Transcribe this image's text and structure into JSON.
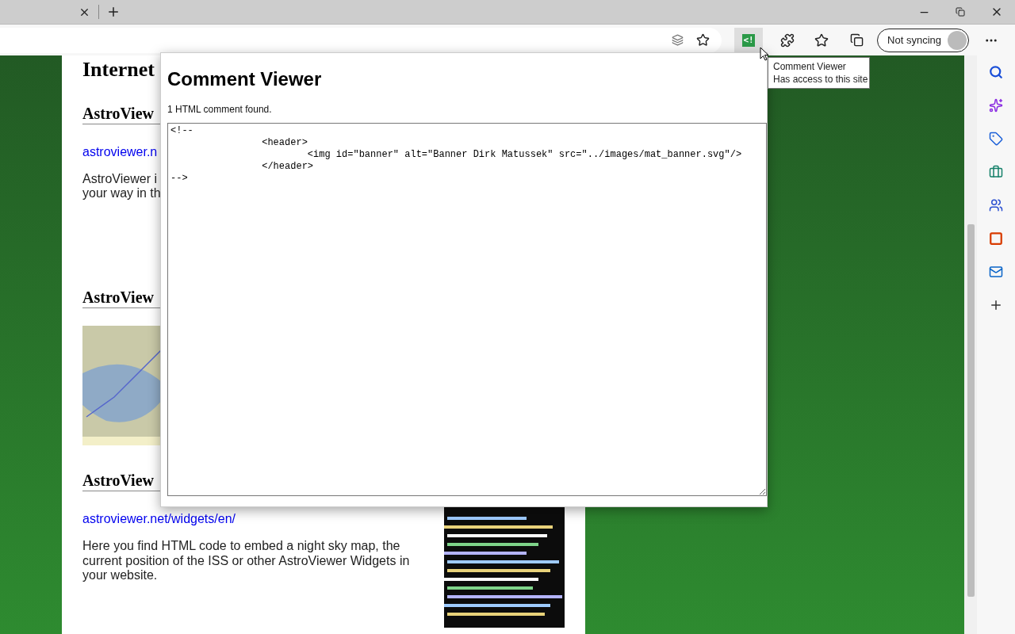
{
  "toolbar": {
    "extension_badge": "<!",
    "sync_button": "Not syncing"
  },
  "tooltip": {
    "title": "Comment Viewer",
    "subtitle": "Has access to this site"
  },
  "popup": {
    "title": "Comment Viewer",
    "count": "1 HTML comment found.",
    "code": "<!--\n\t\t<header>\n\t\t\t<img id=\"banner\" alt=\"Banner Dirk Matussek\" src=\"../images/mat_banner.svg\"/>\n\t\t</header>\n-->"
  },
  "page": {
    "heading": "Internet",
    "sections": [
      {
        "title": "AstroView",
        "link": "astroviewer.n",
        "lines": [
          "AstroViewer i",
          "your way in th"
        ]
      },
      {
        "title": "AstroView"
      },
      {
        "title": "AstroView",
        "link": "astroviewer.net/widgets/en/",
        "text": "Here you find HTML code to embed a night sky map, the current position of the ISS or other AstroViewer Widgets in your website."
      }
    ]
  }
}
